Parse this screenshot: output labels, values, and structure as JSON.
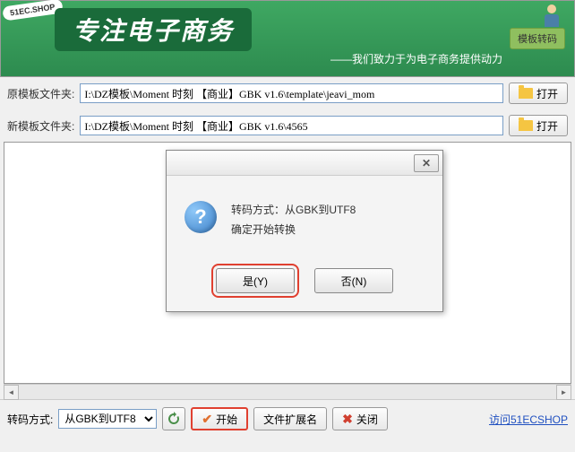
{
  "header": {
    "badge": "51EC.SHOP",
    "title": "专注电子商务",
    "subtitle": "——我们致力于为电子商务提供动力",
    "template_btn": "模板转码"
  },
  "form": {
    "original_label": "原模板文件夹:",
    "original_value": "I:\\DZ模板\\Moment 时刻 【商业】GBK v1.6\\template\\jeavi_mom",
    "new_label": "新模板文件夹:",
    "new_value": "I:\\DZ模板\\Moment 时刻 【商业】GBK v1.6\\4565",
    "open_btn": "打开"
  },
  "footer": {
    "encode_label": "转码方式:",
    "encode_value": "从GBK到UTF8",
    "start_btn": "开始",
    "ext_btn": "文件扩展名",
    "close_btn": "关闭",
    "link": "访问51ECSHOP"
  },
  "dialog": {
    "line1": "转码方式：从GBK到UTF8",
    "line2": "确定开始转换",
    "yes_btn": "是(Y)",
    "no_btn": "否(N)"
  }
}
